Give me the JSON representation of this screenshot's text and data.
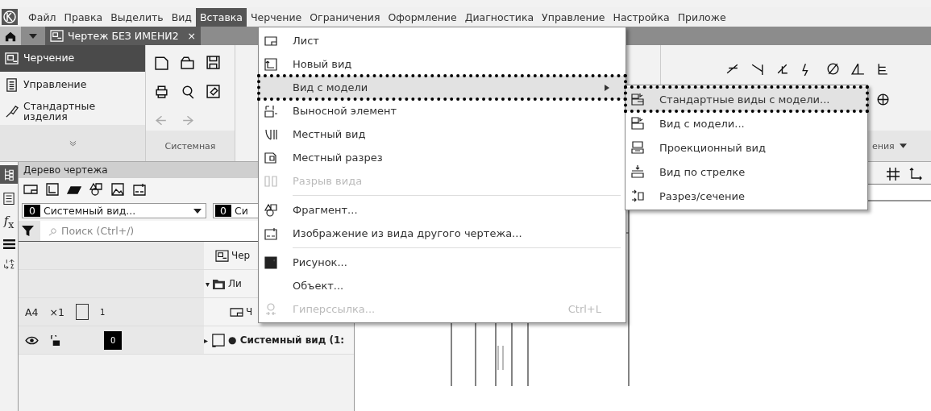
{
  "menubar": {
    "items": [
      {
        "label": "Файл",
        "selected": false
      },
      {
        "label": "Правка",
        "selected": false
      },
      {
        "label": "Выделить",
        "selected": false
      },
      {
        "label": "Вид",
        "selected": false
      },
      {
        "label": "Вставка",
        "selected": true
      },
      {
        "label": "Черчение",
        "selected": false
      },
      {
        "label": "Ограничения",
        "selected": false
      },
      {
        "label": "Оформление",
        "selected": false
      },
      {
        "label": "Диагностика",
        "selected": false
      },
      {
        "label": "Управление",
        "selected": false
      },
      {
        "label": "Настройка",
        "selected": false
      },
      {
        "label": "Приложе",
        "selected": false
      }
    ]
  },
  "document_tab": {
    "title": "Чертеж БЕЗ ИМЕНИ2",
    "close": "×"
  },
  "ribbon_nav": [
    {
      "label": "Черчение",
      "selected": true
    },
    {
      "label": "Управление",
      "selected": false
    },
    {
      "label": "Стандартные изделия",
      "selected": false
    }
  ],
  "side_strip": {
    "function_symbol": "*f*$_{x}$"
  },
  "toolbar_group": {
    "label": "Системная"
  },
  "right_toolbar": {
    "label": "ения"
  },
  "tree_panel": {
    "title": "Дерево чертежа",
    "view_select": {
      "number": "0",
      "value": "Системный вид..."
    },
    "layer_select": {
      "number": "0",
      "value": "Си"
    },
    "search": {
      "placeholder": "Поиск (Ctrl+/)"
    },
    "rows": [
      {
        "kind": "document",
        "label": "Чер"
      },
      {
        "kind": "sheets",
        "toggle": "▾",
        "label": "Ли"
      },
      {
        "kind": "sheet",
        "format": "A4",
        "scale": "×1",
        "number": "1",
        "label": "Ч"
      },
      {
        "kind": "view",
        "layer": "0",
        "toggle": "▸",
        "label": "● Системный вид (1:"
      }
    ]
  },
  "insert_menu": {
    "items": [
      {
        "kind": "item",
        "label": "Лист",
        "selected": false,
        "disabled": false
      },
      {
        "kind": "item",
        "label": "Новый вид",
        "selected": false,
        "disabled": false
      },
      {
        "kind": "item",
        "label": "Вид с модели",
        "selected": true,
        "disabled": false,
        "submenu": true
      },
      {
        "kind": "item",
        "label": "Выносной элемент",
        "selected": false,
        "disabled": false
      },
      {
        "kind": "item",
        "label": "Местный вид",
        "selected": false,
        "disabled": false
      },
      {
        "kind": "item",
        "label": "Местный разрез",
        "selected": false,
        "disabled": false
      },
      {
        "kind": "item",
        "label": "Разрыв вида",
        "selected": false,
        "disabled": true
      },
      {
        "kind": "separator"
      },
      {
        "kind": "item",
        "label": "Фрагмент...",
        "selected": false,
        "disabled": false
      },
      {
        "kind": "item",
        "label": "Изображение из вида другого чертежа...",
        "selected": false,
        "disabled": false
      },
      {
        "kind": "separator"
      },
      {
        "kind": "item",
        "label": "Рисунок...",
        "selected": false,
        "disabled": false
      },
      {
        "kind": "item",
        "label": "Объект...",
        "selected": false,
        "disabled": false
      },
      {
        "kind": "item",
        "label": "Гиперссылка...",
        "selected": false,
        "disabled": true,
        "shortcut": "Ctrl+L"
      }
    ]
  },
  "model_view_submenu": {
    "items": [
      {
        "label": "Стандартные виды с модели...",
        "selected": true
      },
      {
        "label": "Вид с модели...",
        "selected": false
      },
      {
        "label": "Проекционный вид",
        "selected": false
      },
      {
        "label": "Вид по стрелке",
        "selected": false
      },
      {
        "label": "Разрез/сечение",
        "selected": false
      }
    ]
  }
}
